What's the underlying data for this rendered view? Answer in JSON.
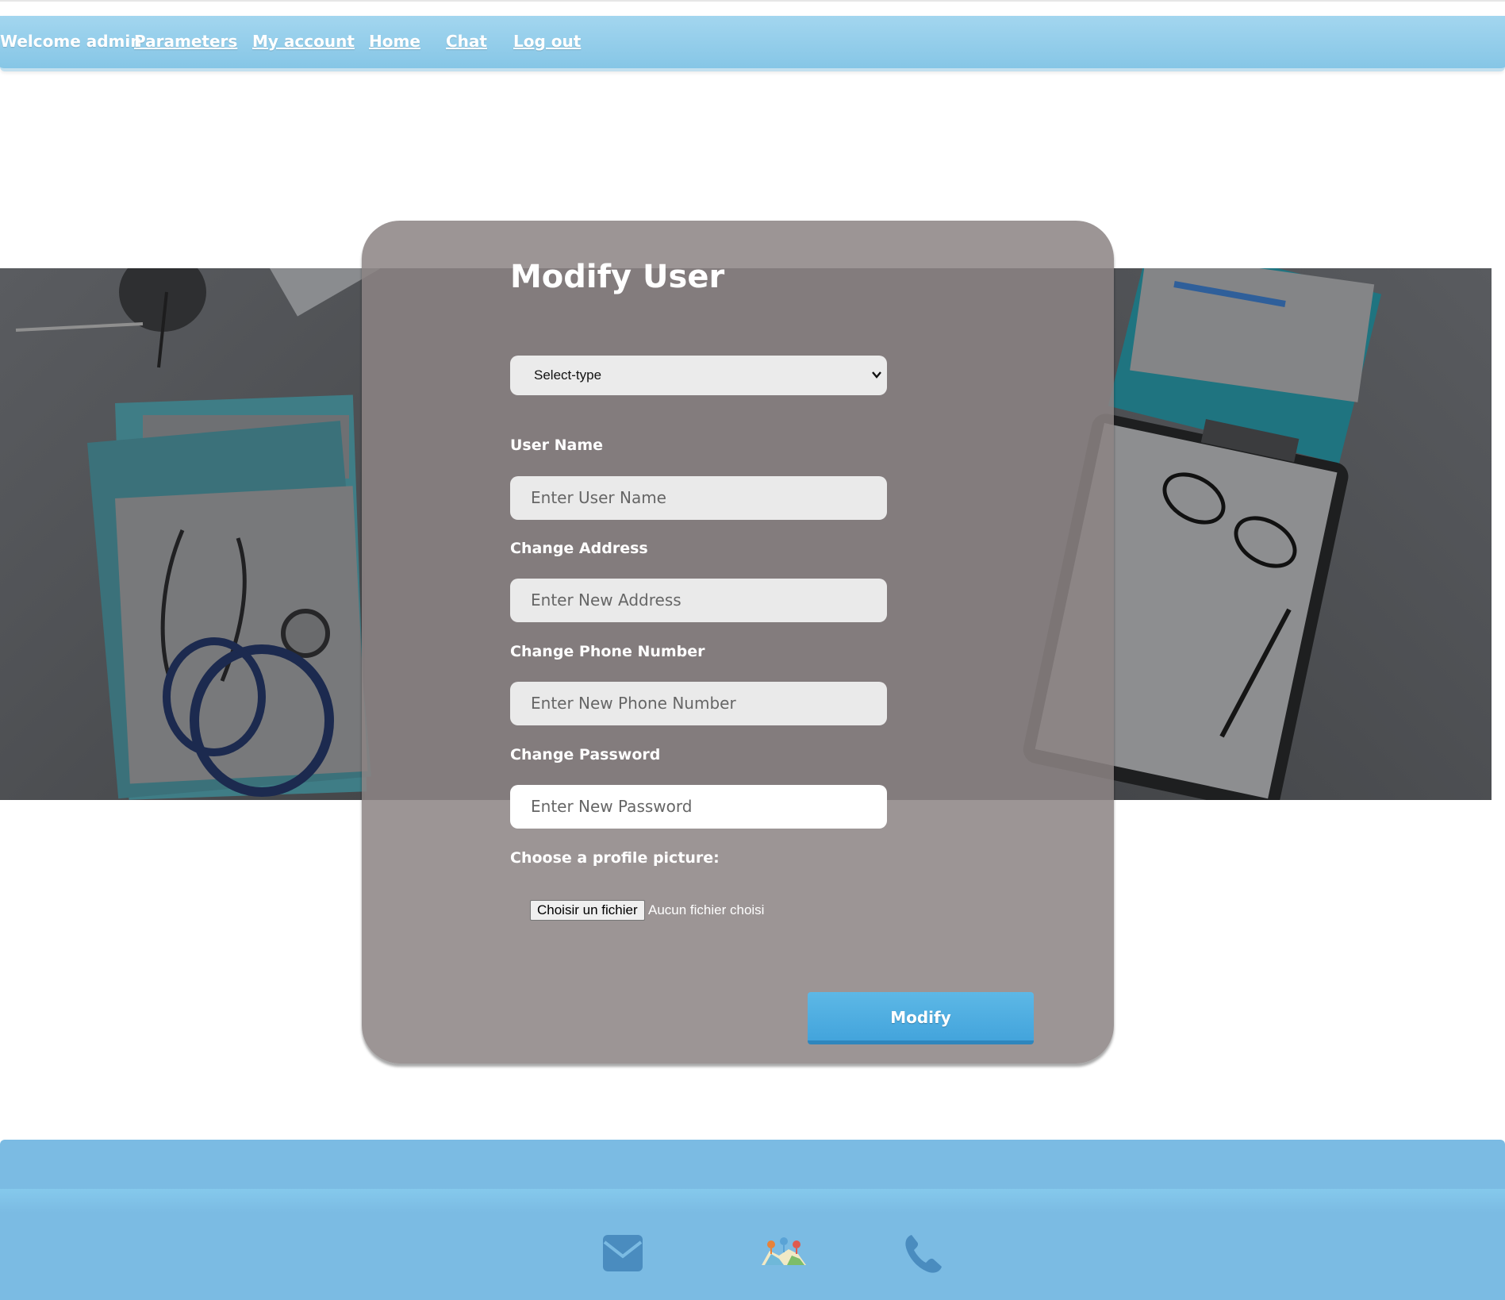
{
  "navbar": {
    "welcome": "Welcome admin",
    "links": [
      "Parameters",
      "My account",
      "Home",
      "Chat",
      "Log out"
    ]
  },
  "form": {
    "title": "Modify User",
    "type_select": {
      "selected": "Select-type"
    },
    "fields": [
      {
        "label": "User Name",
        "placeholder": "Enter User Name"
      },
      {
        "label": "Change Address",
        "placeholder": "Enter  New Address"
      },
      {
        "label": "Change Phone Number",
        "placeholder": "Enter New Phone Number"
      },
      {
        "label": "Change Password",
        "placeholder": "Enter  New Password"
      }
    ],
    "profile_picture": {
      "label": "Choose a profile picture:",
      "button": "Choisir un fichier",
      "status": "Aucun fichier choisi"
    },
    "submit_label": "Modify"
  },
  "footer": {
    "icons": [
      "envelope-icon",
      "map-icon",
      "phone-icon"
    ]
  },
  "colors": {
    "navbar": "#94cfec",
    "footer": "#7bbbe3",
    "card": "#8c8484",
    "button": "#4aaae0",
    "icon": "#4a8cbf"
  }
}
